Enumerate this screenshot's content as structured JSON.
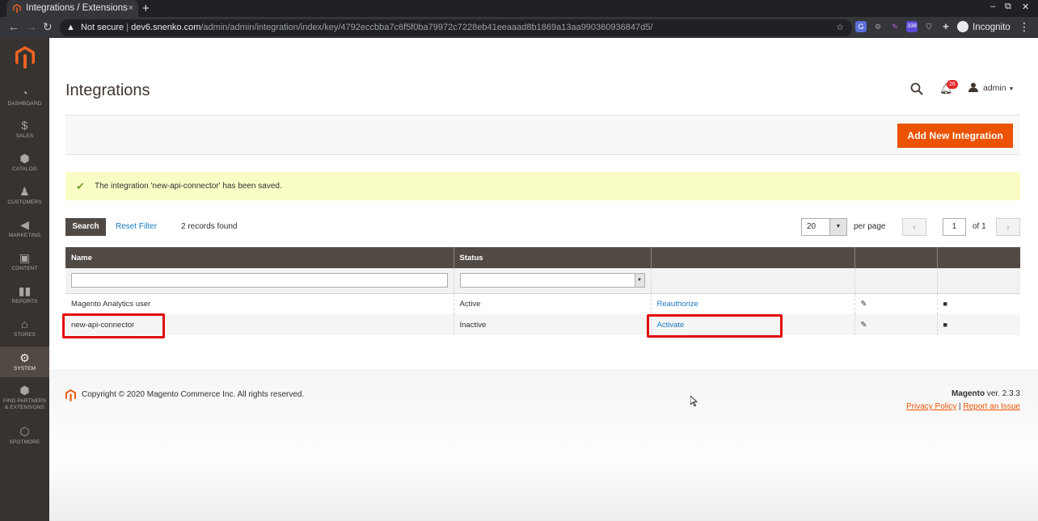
{
  "browser": {
    "tab_title": "Integrations / Extensions",
    "tab_close": "×",
    "new_tab": "+",
    "window_controls": [
      "–",
      "⧉",
      "✕"
    ],
    "url_security": "Not secure",
    "url_host": "dev6.snenko.com",
    "url_path": "/admin/admin/integration/index/key/4792eccbba7c6f5f0ba79972c7228eb41eeaaad8b1869a13aa990360936847d5/",
    "extension_badge": "338",
    "profile": "Incognito"
  },
  "sidebar": {
    "items": [
      {
        "label": "DASHBOARD",
        "icon": "dashboard-icon"
      },
      {
        "label": "SALES",
        "icon": "dollar-icon"
      },
      {
        "label": "CATALOG",
        "icon": "box-icon"
      },
      {
        "label": "CUSTOMERS",
        "icon": "person-icon"
      },
      {
        "label": "MARKETING",
        "icon": "megaphone-icon"
      },
      {
        "label": "CONTENT",
        "icon": "layout-icon"
      },
      {
        "label": "REPORTS",
        "icon": "bar-chart-icon"
      },
      {
        "label": "STORES",
        "icon": "store-icon"
      },
      {
        "label": "SYSTEM",
        "icon": "gear-icon"
      },
      {
        "label": "FIND PARTNERS & EXTENSIONS",
        "icon": "cube-icon"
      },
      {
        "label": "SPOTMORE",
        "icon": "hexagon-icon"
      }
    ],
    "active": "SYSTEM"
  },
  "header": {
    "title": "Integrations",
    "notifications_count": "26",
    "user": "admin"
  },
  "actions": {
    "add_button": "Add New Integration"
  },
  "message": {
    "text": "The integration 'new-api-connector' has been saved."
  },
  "grid_toolbar": {
    "search_button": "Search",
    "reset_filter": "Reset Filter",
    "records_found": "2 records found",
    "per_page_value": "20",
    "per_page_label": "per page",
    "current_page": "1",
    "of_pages": "of 1"
  },
  "grid": {
    "columns": [
      "Name",
      "Status",
      "",
      "",
      ""
    ],
    "rows": [
      {
        "name": "Magento Analytics user",
        "status": "Active",
        "action": "Reauthorize"
      },
      {
        "name": "new-api-connector",
        "status": "Inactive",
        "action": "Activate"
      }
    ]
  },
  "footer": {
    "copyright": "Copyright © 2020 Magento Commerce Inc. All rights reserved.",
    "brand": "Magento",
    "version": " ver. 2.3.3",
    "privacy_policy": "Privacy Policy",
    "separator": "|",
    "report_issue": "Report an Issue"
  },
  "colors": {
    "accent": "#eb5202",
    "sidebar": "#373330",
    "grid_header": "#514943",
    "highlight": "#e20a0a"
  }
}
